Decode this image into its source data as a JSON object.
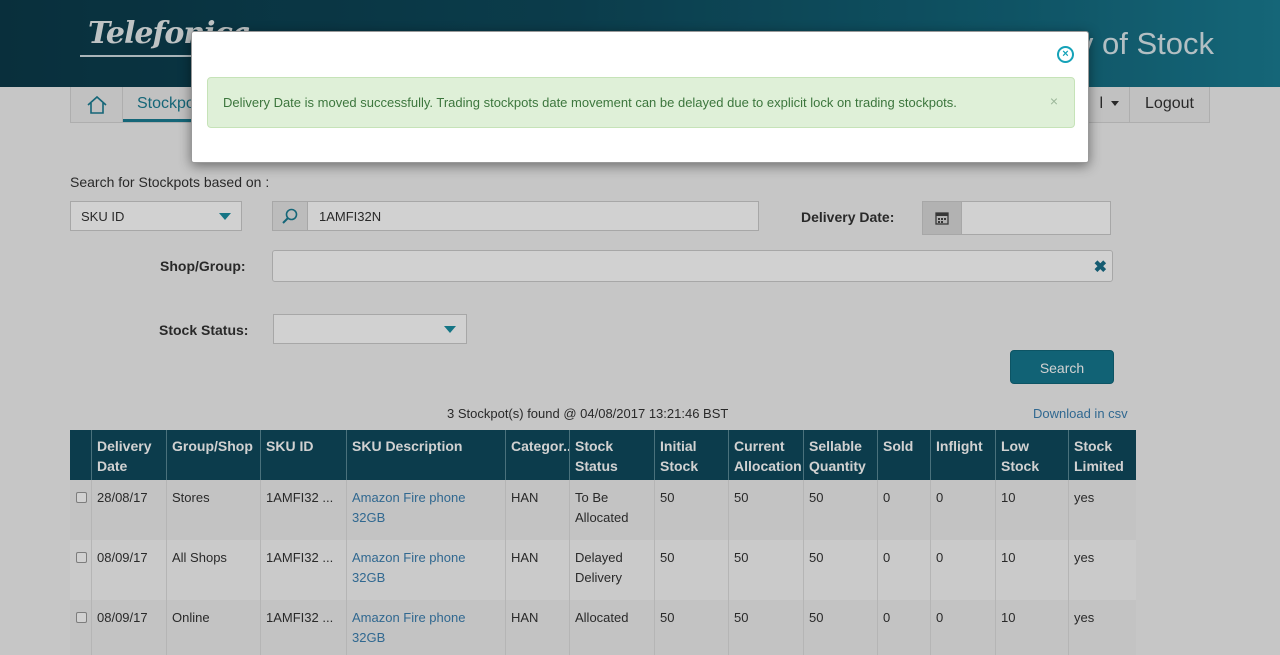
{
  "header": {
    "logo": "Telefonica",
    "title": "v of Stock"
  },
  "nav": {
    "tab": "Stockpots",
    "user_suffix": "l",
    "logout": "Logout"
  },
  "search": {
    "intro_label": "Search for Stockpots based on :",
    "criteria_selected": "SKU ID",
    "search_value": "1AMFI32N",
    "delivery_date_label": "Delivery Date:",
    "delivery_date_value": "",
    "shop_group_label": "Shop/Group:",
    "stock_status_label": "Stock Status:",
    "stock_status_value": "",
    "search_button": "Search"
  },
  "results": {
    "summary": "3 Stockpot(s) found @ 04/08/2017 13:21:46 BST",
    "download": "Download in csv"
  },
  "table": {
    "headers": [
      "Delivery Date",
      "Group/Shop",
      "SKU ID",
      "SKU Description",
      "Categor...",
      "Stock Status",
      "Initial Stock",
      "Current Allocation",
      "Sellable Quantity",
      "Sold",
      "Inflight",
      "Low Stock Level",
      "Stock Limited"
    ],
    "rows": [
      [
        "28/08/17",
        "Stores",
        "1AMFI32 ...",
        "Amazon Fire phone 32GB",
        "HAN",
        "To Be Allocated",
        "50",
        "50",
        "50",
        "0",
        "0",
        "10",
        "yes"
      ],
      [
        "08/09/17",
        "All Shops",
        "1AMFI32 ...",
        "Amazon Fire phone 32GB",
        "HAN",
        "Delayed Delivery",
        "50",
        "50",
        "50",
        "0",
        "0",
        "10",
        "yes"
      ],
      [
        "08/09/17",
        "Online",
        "1AMFI32 ...",
        "Amazon Fire phone 32GB",
        "HAN",
        "Allocated",
        "50",
        "50",
        "50",
        "0",
        "0",
        "10",
        "yes"
      ]
    ]
  },
  "modal": {
    "message": "Delivery Date is moved successfully. Trading stockpots date movement can be delayed due to explicit lock on trading stockpots.",
    "dismiss": "×",
    "close_symbol": "×"
  },
  "colors": {
    "header_dark": "#0b3a4a",
    "accent": "#15788f",
    "alert_bg": "#dff0d8",
    "alert_text": "#3c763d",
    "link": "#3b7fb0"
  },
  "icons": [
    "home-icon",
    "search-icon",
    "calendar-icon",
    "clear-icon",
    "close-icon",
    "chevron-down-icon"
  ]
}
